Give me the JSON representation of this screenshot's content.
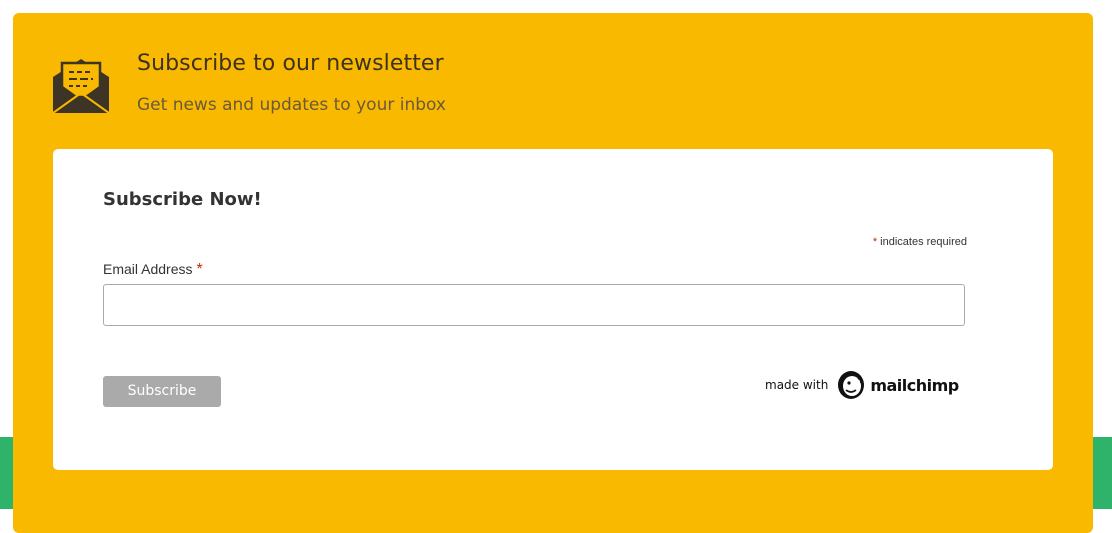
{
  "header": {
    "icon": "envelope-newsletter-icon",
    "title": "Subscribe to our newsletter",
    "subtitle": "Get news and updates to your inbox"
  },
  "form": {
    "heading": "Subscribe Now!",
    "required_asterisk": "*",
    "required_note": "indicates required",
    "email_label": "Email Address",
    "email_value": "",
    "email_placeholder": "",
    "submit_label": "Subscribe"
  },
  "badge": {
    "made_with": "made with",
    "brand": "mailchimp",
    "icon": "mailchimp-freddie-icon"
  },
  "colors": {
    "card_background": "#f8b900",
    "footer_band": "#2fb36b",
    "button_background": "#aaaaaa",
    "required_asterisk": "#c02b0a"
  }
}
